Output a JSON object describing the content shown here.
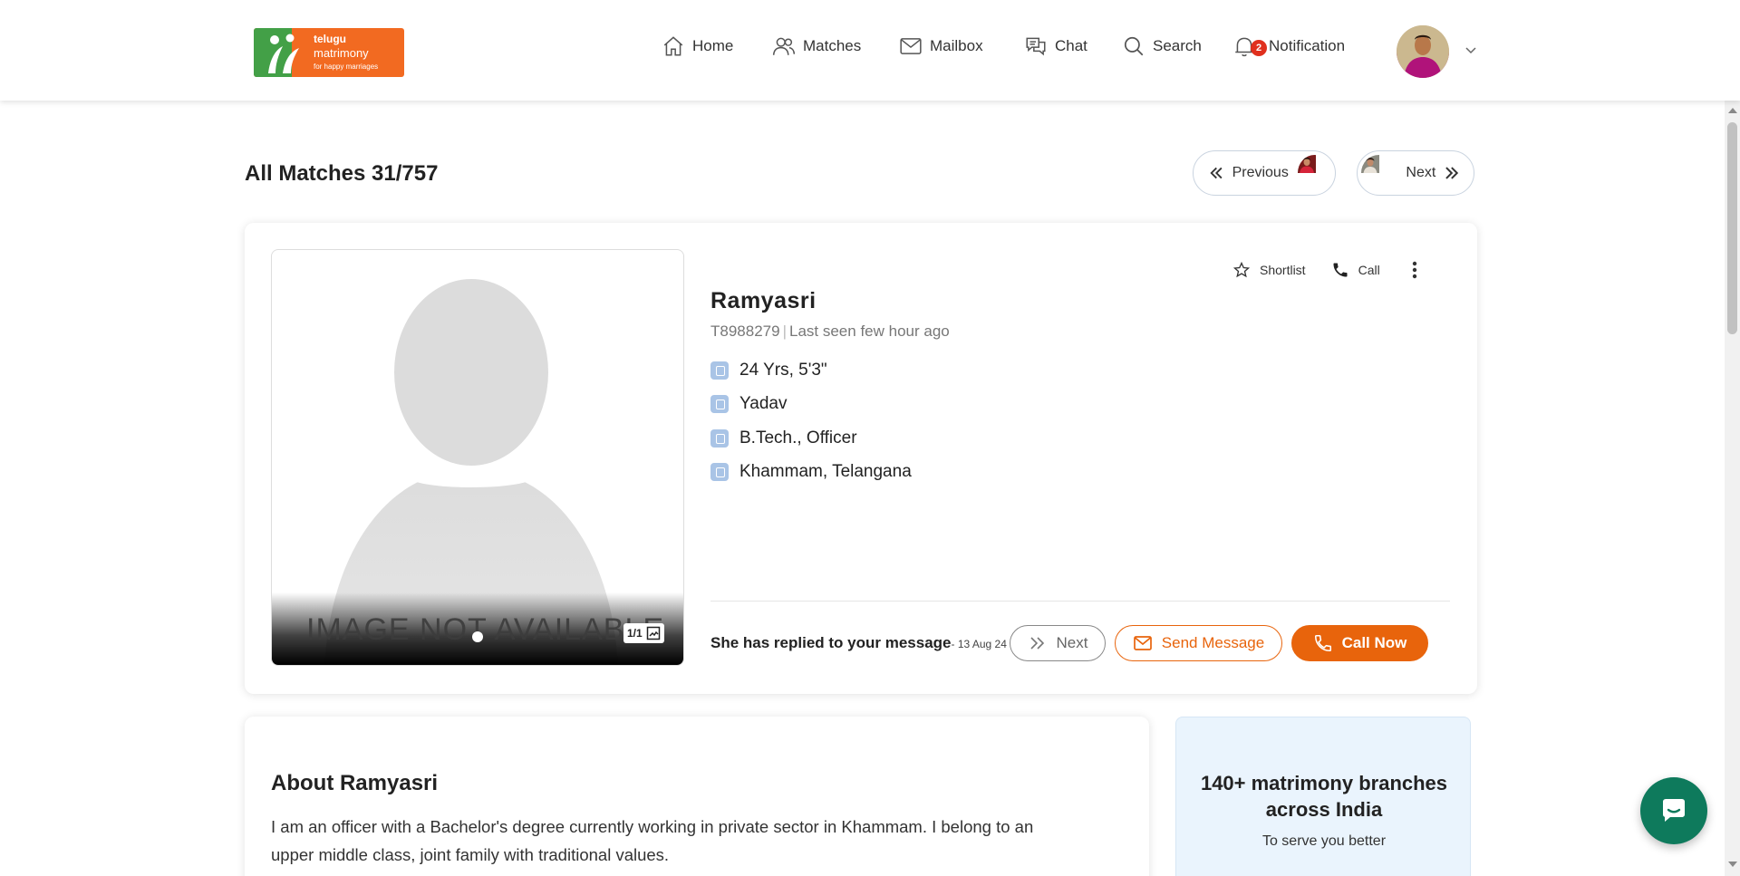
{
  "brand": {
    "line1": "telugu",
    "line2": "matrimony",
    "tagline": "for happy marriages",
    "orange": "#f26a21",
    "green": "#43a047"
  },
  "nav": {
    "home": "Home",
    "matches": "Matches",
    "mailbox": "Mailbox",
    "chat": "Chat",
    "search": "Search",
    "notification": "Notification",
    "notification_count": "2"
  },
  "page": {
    "title": "All Matches 31/757",
    "previous_label": "Previous",
    "next_label": "Next"
  },
  "profile": {
    "name": "Ramyasri",
    "id": "T8988279",
    "last_seen": "Last seen few hour ago",
    "facts": [
      "24 Yrs, 5'3\"",
      "Yadav",
      "B.Tech., Officer",
      "Khammam, Telangana"
    ],
    "photo_placeholder": "IMAGE NOT AVAILABLE",
    "photo_count": "1/1",
    "shortlist_label": "Shortlist",
    "call_label": "Call",
    "replied_text": "She has replied to your message",
    "replied_date": "- 13 Aug 24",
    "next_btn": "Next",
    "send_message_btn": "Send Message",
    "call_now_btn": "Call Now",
    "accent": "#e8640c"
  },
  "about": {
    "title": "About Ramyasri",
    "text": "I am an officer with a Bachelor's degree currently working in private sector in Khammam. I belong to an upper middle class, joint family with traditional values."
  },
  "branches": {
    "title": "140+ matrimony branches across India",
    "subtitle": "To serve you better"
  }
}
